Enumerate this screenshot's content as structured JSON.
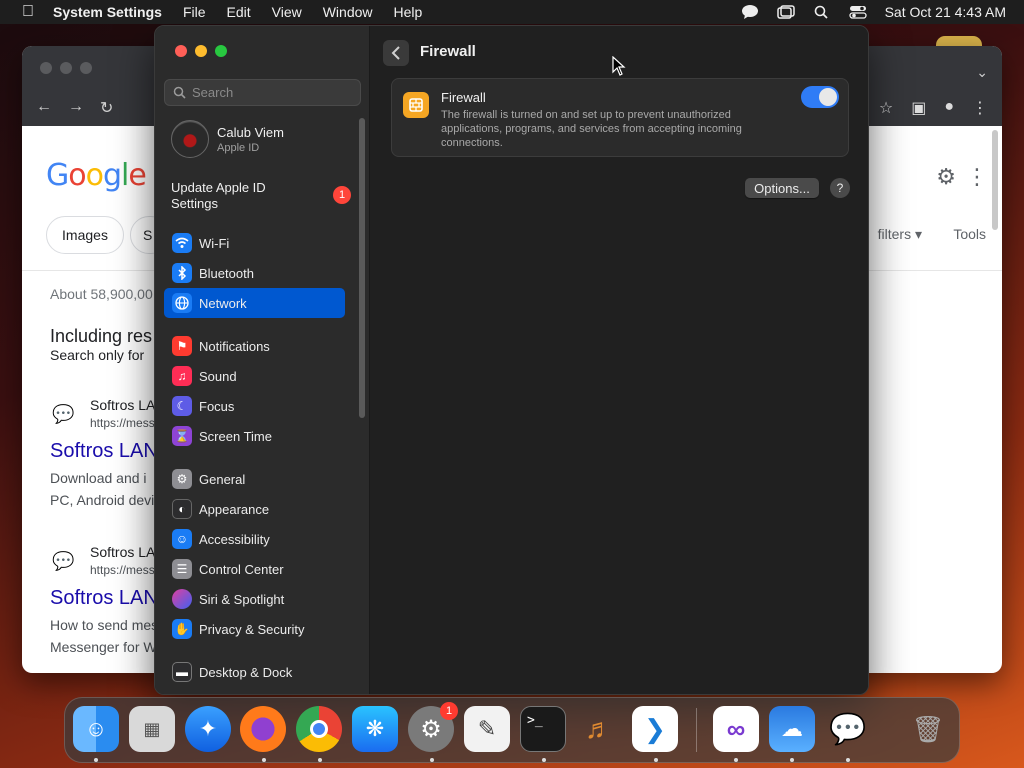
{
  "menubar": {
    "app_name": "System Settings",
    "menus": [
      "File",
      "Edit",
      "View",
      "Window",
      "Help"
    ],
    "clock": "Sat Oct 21  4:43 AM"
  },
  "browser": {
    "logo": "Google",
    "chips": [
      "Images",
      "S"
    ],
    "filters": "filters",
    "tools": "Tools",
    "results_count": "About 58,900,00",
    "including": "Including res",
    "search_only": "Search only for",
    "r1_site": "Softros LA",
    "r1_url": "https://mess",
    "r1_title": "Softros LAN",
    "r1_snippet_a": "Download and i",
    "r1_snippet_b": "PC, Android devi",
    "r2_site": "Softros LA",
    "r2_url": "https://mess",
    "r2_title": "Softros LAN",
    "r2_snippet_a": "How to send mes",
    "r2_snippet_b": "Messenger for W"
  },
  "sidebar": {
    "search_placeholder": "Search",
    "profile_name": "Calub Viem",
    "profile_sub": "Apple ID",
    "update_label": "Update Apple ID Settings",
    "update_badge": "1",
    "items": [
      {
        "label": "Wi-Fi",
        "color": "#1a7cf5",
        "icon": "wifi-icon"
      },
      {
        "label": "Bluetooth",
        "color": "#1a7cf5",
        "icon": "bluetooth-icon"
      },
      {
        "label": "Network",
        "color": "#1a7cf5",
        "icon": "globe-icon"
      },
      {
        "label": "Notifications",
        "color": "#ff3b30",
        "icon": "bell-icon"
      },
      {
        "label": "Sound",
        "color": "#ff2d55",
        "icon": "speaker-icon"
      },
      {
        "label": "Focus",
        "color": "#5e5ce6",
        "icon": "moon-icon"
      },
      {
        "label": "Screen Time",
        "color": "#8e44d6",
        "icon": "hourglass-icon"
      },
      {
        "label": "General",
        "color": "#8e8e93",
        "icon": "gear-icon"
      },
      {
        "label": "Appearance",
        "color": "#2c2c2e",
        "icon": "appearance-icon"
      },
      {
        "label": "Accessibility",
        "color": "#1a7cf5",
        "icon": "accessibility-icon"
      },
      {
        "label": "Control Center",
        "color": "#8e8e93",
        "icon": "control-center-icon"
      },
      {
        "label": "Siri & Spotlight",
        "color": "#b03ad6",
        "icon": "siri-icon"
      },
      {
        "label": "Privacy & Security",
        "color": "#1a7cf5",
        "icon": "hand-icon"
      },
      {
        "label": "Desktop & Dock",
        "color": "#2c2c2e",
        "icon": "dock-icon"
      }
    ]
  },
  "content": {
    "title": "Firewall",
    "card_title": "Firewall",
    "card_desc": "The firewall is turned on and set up to prevent unauthorized applications, programs, and services from accepting incoming connections.",
    "toggle_on": true,
    "options_label": "Options...",
    "help_label": "?"
  },
  "dock": {
    "icons": [
      "finder-icon",
      "launchpad-icon",
      "safari-icon",
      "firefox-icon",
      "chrome-icon",
      "app-store-icon",
      "system-settings-icon",
      "textedit-icon",
      "terminal-icon",
      "garageband-icon",
      "vscode-icon",
      "visual-studio-icon",
      "weather-icon",
      "softros-messenger-icon",
      "trash-icon"
    ],
    "settings_badge": "1"
  }
}
